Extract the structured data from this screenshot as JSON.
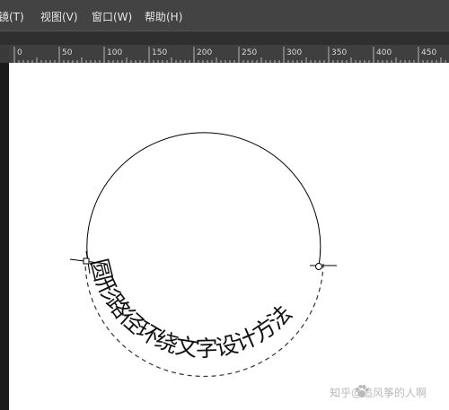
{
  "menu": {
    "items": [
      {
        "label": "滤镜(T)"
      },
      {
        "label": "视图(V)"
      },
      {
        "label": "窗口(W)"
      },
      {
        "label": "帮助(H)"
      }
    ]
  },
  "ruler": {
    "unit_labels": [
      "0",
      "50",
      "100",
      "150",
      "200",
      "250",
      "300",
      "350",
      "400",
      "450"
    ]
  },
  "canvas": {
    "path_text": "圆形路径环绕文字设计方法"
  },
  "watermark": {
    "site": "知乎",
    "author": "@追风筝的人啊"
  }
}
